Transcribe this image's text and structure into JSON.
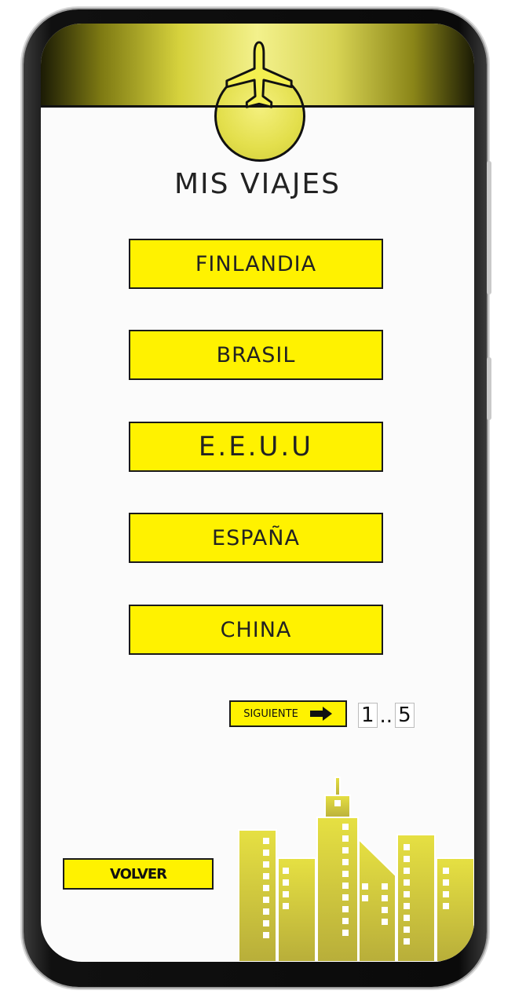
{
  "header": {
    "icon": "airplane-icon",
    "accent": "#e8e45a"
  },
  "title": "MIS VIAJES",
  "countries": [
    {
      "label": "FINLANDIA"
    },
    {
      "label": "BRASIL"
    },
    {
      "label": "E.E.U.U"
    },
    {
      "label": "ESPAÑA"
    },
    {
      "label": "CHINA"
    }
  ],
  "pagination": {
    "next_label": "SIGUIENTE",
    "next_icon": "arrow-right-icon",
    "current": "1",
    "separator": "..",
    "total": "5"
  },
  "back_label": "VOLVER",
  "colors": {
    "button": "#fff200",
    "border": "#1a1a1a",
    "city": "#d8d23c"
  },
  "illustration": "city-skyline"
}
